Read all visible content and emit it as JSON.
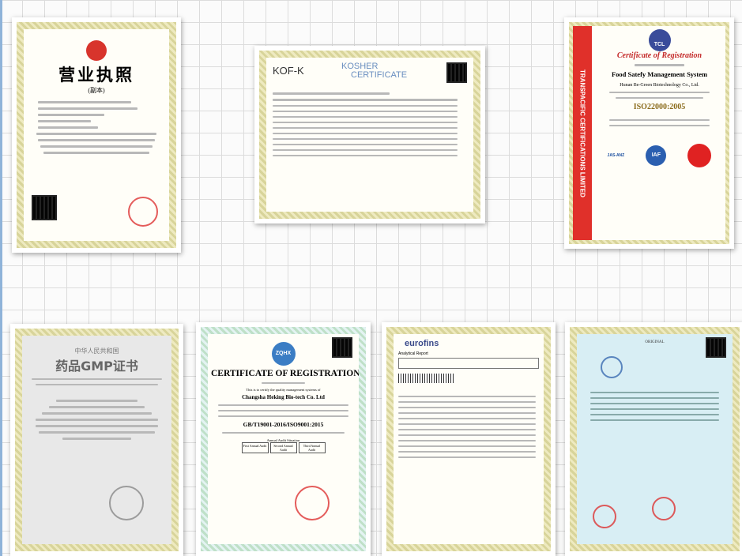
{
  "certificates": [
    {
      "title": "营业执照",
      "subtitle": "(副本)"
    },
    {
      "logo": "KOF-K",
      "title_line1": "KOSHER",
      "title_line2": "CERTIFICATE"
    },
    {
      "side_text": "TRANSPACIFIC CERTIFICATIONS LIMITED",
      "logo": "TCL",
      "title": "Certificate of Registration",
      "system": "Food Satefy  Management System",
      "company": "Hunan Be-Green Biotechnology Co., Ltd.",
      "standard": "ISO22000:2005",
      "badges": [
        "JAS-ANZ",
        "IAF"
      ]
    },
    {
      "header": "中华人民共和国",
      "title": "药品GMP证书"
    },
    {
      "logo": "ZQHX",
      "title": "CERTIFICATE OF REGISTRATION",
      "intro": "This is to certify the quality management systems of",
      "company": "Changsha Heking Bio-tech Co. Ltd",
      "standard": "GB/T19001-2016/ISO9001:2015",
      "audit_heading": "Annual Audit Situation",
      "audits": [
        "First Annual Audit",
        "Second Annual Audit",
        "Third Annual Audit"
      ]
    },
    {
      "logo": "eurofins",
      "title": "Analytical Report"
    },
    {
      "title": "ORIGINAL"
    }
  ],
  "colors": {
    "gold_border": "#d8d49a",
    "red_band": "#e0302a",
    "blue_cert": "#d8eef4"
  }
}
